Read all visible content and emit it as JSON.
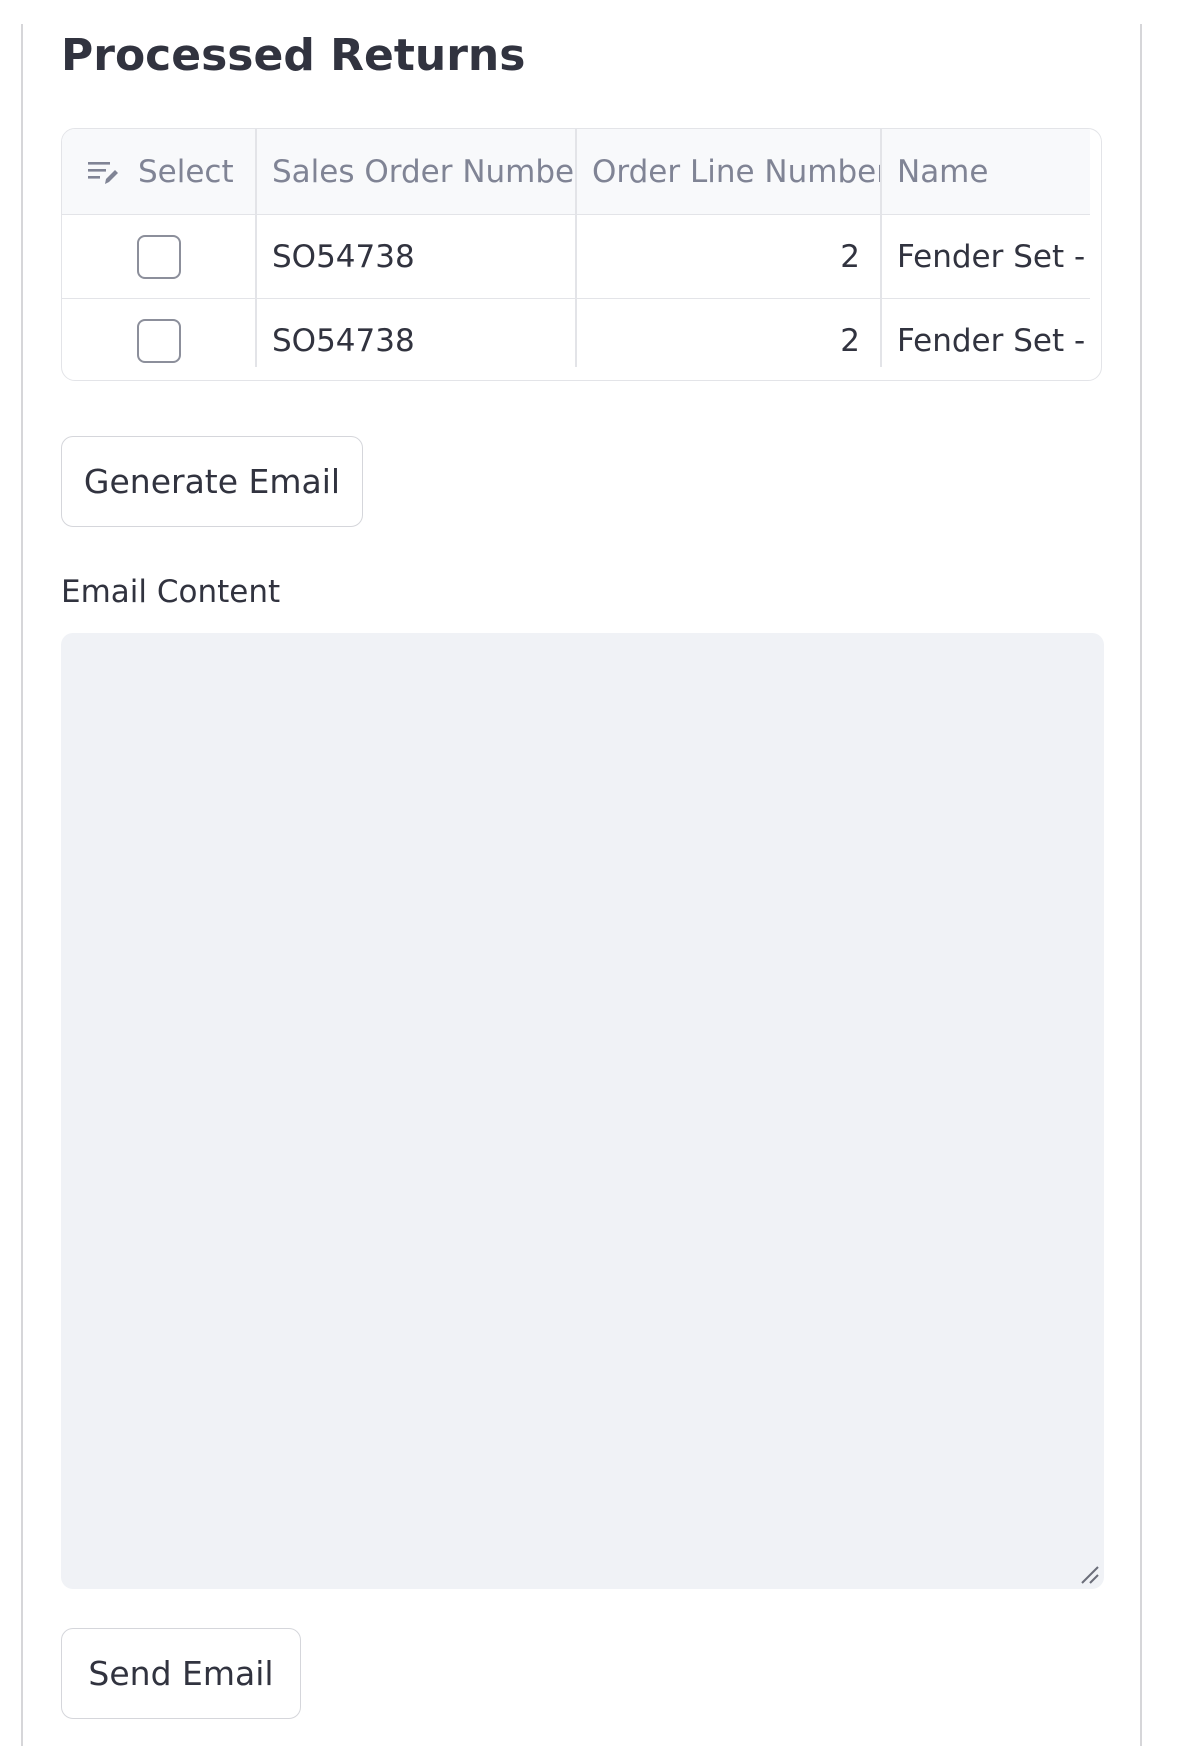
{
  "section": {
    "title": "Processed Returns"
  },
  "table": {
    "columns": [
      "Select",
      "Sales Order Number",
      "Order Line Number",
      "Name"
    ],
    "rows": [
      {
        "selected": false,
        "sales_order_number": "SO54738",
        "order_line_number": "2",
        "name": "Fender Set - M"
      },
      {
        "selected": false,
        "sales_order_number": "SO54738",
        "order_line_number": "2",
        "name": "Fender Set - M"
      }
    ]
  },
  "buttons": {
    "generate_label": "Generate Email",
    "send_label": "Send Email"
  },
  "email": {
    "label": "Email Content",
    "value": ""
  },
  "colors": {
    "text": "#31333f",
    "header_text": "#808495",
    "textarea_bg": "#f0f2f6",
    "border": "#e3e4e8"
  },
  "icons": {
    "select_column": "edit-list-icon",
    "textarea_resize": "resize-handle-icon"
  }
}
